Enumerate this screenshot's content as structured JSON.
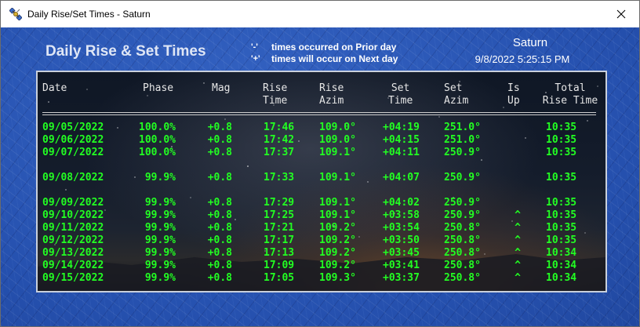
{
  "window": {
    "title": "Daily Rise/Set Times - Saturn",
    "app_icon": "satellite-icon",
    "close_icon": "close-icon"
  },
  "header": {
    "heading": "Daily Rise & Set Times",
    "legend": [
      {
        "symbol": "'-'",
        "text": "times occurred on Prior day"
      },
      {
        "symbol": "'+'",
        "text": "times will occur on Next day"
      }
    ],
    "planet": "Saturn",
    "timestamp": "9/8/2022 5:25:15 PM"
  },
  "table": {
    "columns": [
      {
        "key": "date",
        "line1": "Date",
        "line2": ""
      },
      {
        "key": "phase",
        "line1": "Phase",
        "line2": ""
      },
      {
        "key": "mag",
        "line1": "Mag",
        "line2": ""
      },
      {
        "key": "rise_time",
        "line1": "Rise",
        "line2": "Time"
      },
      {
        "key": "rise_azim",
        "line1": "Rise",
        "line2": "Azim"
      },
      {
        "key": "set_time",
        "line1": "Set",
        "line2": "Time"
      },
      {
        "key": "set_azim",
        "line1": "Set",
        "line2": "Azim"
      },
      {
        "key": "is_up",
        "line1": "Is",
        "line2": "Up"
      },
      {
        "key": "total",
        "line1": "Total",
        "line2": "Rise Time"
      }
    ],
    "rows": [
      {
        "date": "09/05/2022",
        "phase": "100.0%",
        "mag": "+0.8",
        "rise_time": "17:46",
        "rise_azim": "109.0°",
        "set_time": "+04:19",
        "set_azim": "251.0°",
        "is_up": "",
        "total": "10:35"
      },
      {
        "date": "09/06/2022",
        "phase": "100.0%",
        "mag": "+0.8",
        "rise_time": "17:42",
        "rise_azim": "109.0°",
        "set_time": "+04:15",
        "set_azim": "251.0°",
        "is_up": "",
        "total": "10:35"
      },
      {
        "date": "09/07/2022",
        "phase": "100.0%",
        "mag": "+0.8",
        "rise_time": "17:37",
        "rise_azim": "109.1°",
        "set_time": "+04:11",
        "set_azim": "250.9°",
        "is_up": "",
        "total": "10:35"
      },
      {
        "date": "09/08/2022",
        "phase": "99.9%",
        "mag": "+0.8",
        "rise_time": "17:33",
        "rise_azim": "109.1°",
        "set_time": "+04:07",
        "set_azim": "250.9°",
        "is_up": "",
        "total": "10:35"
      },
      {
        "date": "09/09/2022",
        "phase": "99.9%",
        "mag": "+0.8",
        "rise_time": "17:29",
        "rise_azim": "109.1°",
        "set_time": "+04:02",
        "set_azim": "250.9°",
        "is_up": "",
        "total": "10:35"
      },
      {
        "date": "09/10/2022",
        "phase": "99.9%",
        "mag": "+0.8",
        "rise_time": "17:25",
        "rise_azim": "109.1°",
        "set_time": "+03:58",
        "set_azim": "250.9°",
        "is_up": "^",
        "total": "10:35"
      },
      {
        "date": "09/11/2022",
        "phase": "99.9%",
        "mag": "+0.8",
        "rise_time": "17:21",
        "rise_azim": "109.2°",
        "set_time": "+03:54",
        "set_azim": "250.8°",
        "is_up": "^",
        "total": "10:35"
      },
      {
        "date": "09/12/2022",
        "phase": "99.9%",
        "mag": "+0.8",
        "rise_time": "17:17",
        "rise_azim": "109.2°",
        "set_time": "+03:50",
        "set_azim": "250.8°",
        "is_up": "^",
        "total": "10:35"
      },
      {
        "date": "09/13/2022",
        "phase": "99.9%",
        "mag": "+0.8",
        "rise_time": "17:13",
        "rise_azim": "109.2°",
        "set_time": "+03:45",
        "set_azim": "250.8°",
        "is_up": "^",
        "total": "10:34"
      },
      {
        "date": "09/14/2022",
        "phase": "99.9%",
        "mag": "+0.8",
        "rise_time": "17:09",
        "rise_azim": "109.2°",
        "set_time": "+03:41",
        "set_azim": "250.8°",
        "is_up": "^",
        "total": "10:34"
      },
      {
        "date": "09/15/2022",
        "phase": "99.9%",
        "mag": "+0.8",
        "rise_time": "17:05",
        "rise_azim": "109.3°",
        "set_time": "+03:37",
        "set_azim": "250.8°",
        "is_up": "^",
        "total": "10:34"
      }
    ]
  },
  "colors": {
    "background": "#2a56b4",
    "row_text": "#22ff22",
    "header_text": "#e6e6e6"
  }
}
